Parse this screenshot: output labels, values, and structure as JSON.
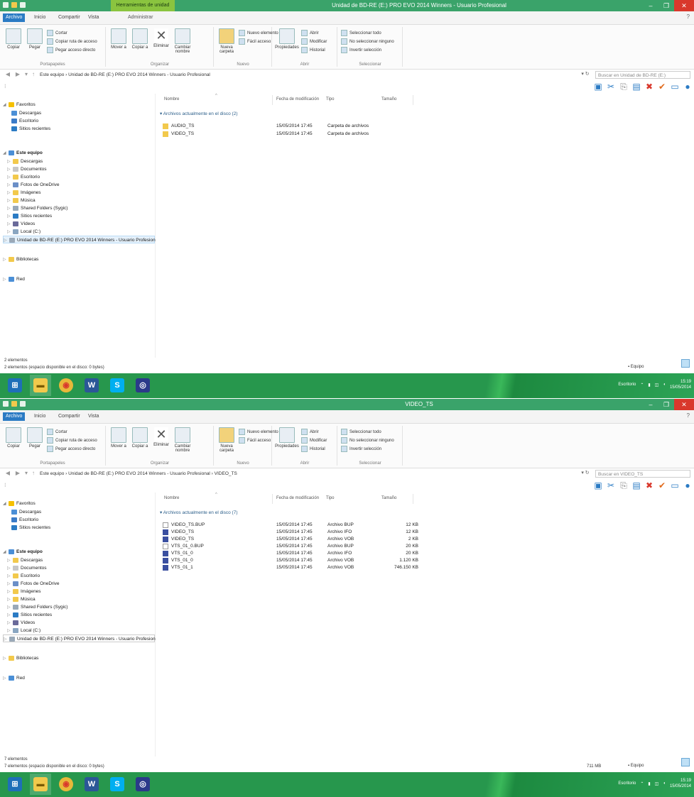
{
  "windows": [
    {
      "title": "Unidad de BD-RE (E:) PRO EVO 2014 Winners - Usuario Profesional",
      "context_tab": "Herramientas de unidad",
      "tabs": [
        "Archivo",
        "Inicio",
        "Compartir",
        "Vista",
        "Administrar"
      ],
      "ribbon": {
        "clipboard": {
          "label": "Portapapeles",
          "copy": "Copiar",
          "paste": "Pegar",
          "cut": "Cortar",
          "copy_path": "Copiar ruta de acceso",
          "paste_shortcut": "Pegar acceso directo"
        },
        "organize": {
          "label": "Organizar",
          "move": "Mover a",
          "copy": "Copiar a",
          "delete": "Eliminar",
          "rename": "Cambiar nombre"
        },
        "new": {
          "label": "Nuevo",
          "new_folder": "Nueva carpeta",
          "new_item": "Nuevo elemento",
          "easy_access": "Fácil acceso"
        },
        "open": {
          "label": "Abrir",
          "properties": "Propiedades",
          "open": "Abrir",
          "edit": "Modificar",
          "history": "Historial"
        },
        "select": {
          "label": "Seleccionar",
          "all": "Seleccionar todo",
          "none": "No seleccionar ninguno",
          "invert": "Invertir selección"
        }
      },
      "address": "Este equipo › Unidad de BD-RE (E:) PRO EVO 2014 Winners - Usuario Profesional",
      "search_placeholder": "Buscar en Unidad de BD-RE (E:)",
      "columns": [
        "Nombre",
        "Fecha de modificación",
        "Tipo",
        "Tamaño"
      ],
      "group_header": "Archivos actualmente en el disco (2)",
      "files": [
        {
          "name": "AUDIO_TS",
          "date": "15/05/2014 17:45",
          "type": "Carpeta de archivos",
          "size": ""
        },
        {
          "name": "VIDEO_TS",
          "date": "15/05/2014 17:45",
          "type": "Carpeta de archivos",
          "size": ""
        }
      ],
      "status1": "2 elementos",
      "status2": "2 elementos (espacio disponible en el disco: 0 bytes)",
      "selected_size": "",
      "status_computer": "Equipo"
    },
    {
      "title": "VIDEO_TS",
      "context_tab": "",
      "tabs": [
        "Archivo",
        "Inicio",
        "Compartir",
        "Vista",
        ""
      ],
      "ribbon": {
        "clipboard": {
          "label": "Portapapeles",
          "copy": "Copiar",
          "paste": "Pegar",
          "cut": "Cortar",
          "copy_path": "Copiar ruta de acceso",
          "paste_shortcut": "Pegar acceso directo"
        },
        "organize": {
          "label": "Organizar",
          "move": "Mover a",
          "copy": "Copiar a",
          "delete": "Eliminar",
          "rename": "Cambiar nombre"
        },
        "new": {
          "label": "Nuevo",
          "new_folder": "Nueva carpeta",
          "new_item": "Nuevo elemento",
          "easy_access": "Fácil acceso"
        },
        "open": {
          "label": "Abrir",
          "properties": "Propiedades",
          "open": "Abrir",
          "edit": "Modificar",
          "history": "Historial"
        },
        "select": {
          "label": "Seleccionar",
          "all": "Seleccionar todo",
          "none": "No seleccionar ninguno",
          "invert": "Invertir selección"
        }
      },
      "address": "Este equipo › Unidad de BD-RE (E:) PRO EVO 2014 Winners - Usuario Profesional › VIDEO_TS",
      "search_placeholder": "Buscar en VIDEO_TS",
      "columns": [
        "Nombre",
        "Fecha de modificación",
        "Tipo",
        "Tamaño"
      ],
      "group_header": "Archivos actualmente en el disco (7)",
      "files": [
        {
          "name": "VIDEO_TS.BUP",
          "date": "15/05/2014 17:45",
          "type": "Archivo BUP",
          "size": "12 KB"
        },
        {
          "name": "VIDEO_TS",
          "date": "15/05/2014 17:45",
          "type": "Archivo IFO",
          "size": "12 KB"
        },
        {
          "name": "VIDEO_TS",
          "date": "15/05/2014 17:45",
          "type": "Archivo VOB",
          "size": "2 KB"
        },
        {
          "name": "VTS_01_0.BUP",
          "date": "15/05/2014 17:45",
          "type": "Archivo BUP",
          "size": "20 KB"
        },
        {
          "name": "VTS_01_0",
          "date": "15/05/2014 17:45",
          "type": "Archivo IFO",
          "size": "20 KB"
        },
        {
          "name": "VTS_01_0",
          "date": "15/05/2014 17:45",
          "type": "Archivo VOB",
          "size": "1.120 KB"
        },
        {
          "name": "VTS_01_1",
          "date": "15/05/2014 17:45",
          "type": "Archivo VOB",
          "size": "746.150 KB"
        }
      ],
      "status1": "7 elementos",
      "status2": "7 elementos (espacio disponible en el disco: 0 bytes)",
      "selected_size": "711 MB",
      "status_computer": "Equipo"
    }
  ],
  "nav": {
    "favorites": "Favoritos",
    "fav_items": [
      "Descargas",
      "Escritorio",
      "Sitios recientes"
    ],
    "this_pc": "Este equipo",
    "pc_items": [
      "Descargas",
      "Documentos",
      "Escritorio",
      "Fotos de OneDrive",
      "Imágenes",
      "Música",
      "Shared Folders (Sygic)",
      "Sitios recientes",
      "Vídeos",
      "Local (C:)"
    ],
    "drive_selected": "Unidad de BD-RE (E:) PRO EVO 2014 Winners - Usuario Profesional",
    "libraries": "Bibliotecas",
    "network": "Red"
  },
  "taskbar": {
    "apps": [
      "Explorador",
      "Chrome",
      "Word",
      "Skype",
      "Media"
    ],
    "tray_text": "Escritorio",
    "time": "15:19",
    "date": "15/05/2014"
  },
  "colors": {
    "titlebar": "#3aa36a",
    "accent": "#2b7bc4",
    "close": "#d9382c",
    "taskbar": "#27974d"
  }
}
